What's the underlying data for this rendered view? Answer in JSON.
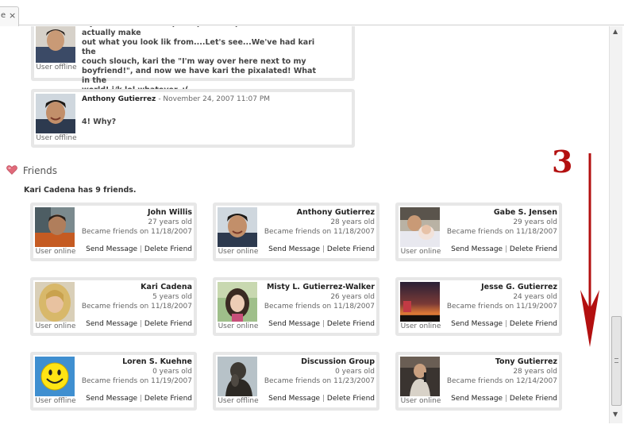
{
  "tab": {
    "label": "e",
    "close_glyph": "×"
  },
  "comments": [
    {
      "status": "User offline",
      "body": [
        "My dear Kari.  Please put a picture up that we can actually make",
        "out what you look lik from....Let's see...We've had kari the",
        "couch slouch, kari the \"I'm way over here next to my",
        "boyfriend!\", and now we have kari the pixalated!  What in the",
        "world! j/k lol whatever. :("
      ]
    },
    {
      "author": "Anthony Gutierrez",
      "date": "- November 24, 2007 11:07 PM",
      "body": [
        "4! Why?"
      ],
      "status": "User offline"
    }
  ],
  "friends": {
    "heading": "Friends",
    "count_text": "Kari Cadena has 9 friends.",
    "send_label": "Send Message",
    "separator": "|",
    "delete_label": "Delete Friend",
    "cards": [
      {
        "name": "John Willis",
        "age": "27 years old",
        "since": "Became friends on 11/18/2007",
        "status": "User online",
        "picture": "man-in-orange-shirt"
      },
      {
        "name": "Anthony Gutierrez",
        "age": "28 years old",
        "since": "Became friends on 11/18/2007",
        "status": "User online",
        "picture": "man-smiling"
      },
      {
        "name": "Gabe S. Jensen",
        "age": "29 years old",
        "since": "Became friends on 11/18/2007",
        "status": "User online",
        "picture": "man-holding-baby"
      },
      {
        "name": "Kari Cadena",
        "age": "5 years old",
        "since": "Became friends on 11/18/2007",
        "status": "User online",
        "picture": "blonde-woman"
      },
      {
        "name": "Misty L. Gutierrez-Walker",
        "age": "26 years old",
        "since": "Became friends on 11/18/2007",
        "status": "User online",
        "picture": "dark-haired-woman"
      },
      {
        "name": "Jesse G. Gutierrez",
        "age": "24 years old",
        "since": "Became friends on 11/19/2007",
        "status": "User online",
        "picture": "sunset-sky"
      },
      {
        "name": "Loren S. Kuehne",
        "age": "0 years old",
        "since": "Became friends on 11/19/2007",
        "status": "User offline",
        "picture": "smiley-face"
      },
      {
        "name": "Discussion Group",
        "age": "0 years old",
        "since": "Became friends on 11/23/2007",
        "status": "User offline",
        "picture": "thinker-statue"
      },
      {
        "name": "Tony Gutierrez",
        "age": "28 years old",
        "since": "Became friends on 12/14/2007",
        "status": "User online",
        "picture": "man-singing"
      }
    ]
  },
  "annotation": {
    "number": "3",
    "color": "#b31010",
    "direction": "down"
  }
}
